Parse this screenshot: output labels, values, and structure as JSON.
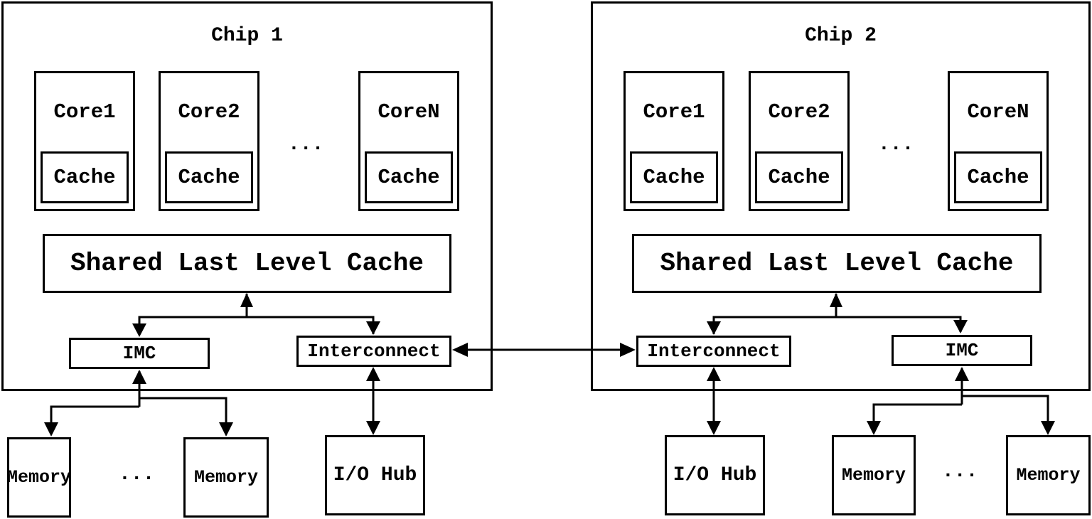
{
  "chips": [
    {
      "title": "Chip 1",
      "cores": [
        {
          "label": "Core1",
          "cache": "Cache"
        },
        {
          "label": "Core2",
          "cache": "Cache"
        },
        {
          "label": "CoreN",
          "cache": "Cache"
        }
      ],
      "ellipsis": "...",
      "llc": "Shared Last Level Cache",
      "imc": "IMC",
      "interconnect": "Interconnect",
      "memory": [
        "Memory",
        "Memory"
      ],
      "memory_ellipsis": "...",
      "io_hub": "I/O Hub"
    },
    {
      "title": "Chip 2",
      "cores": [
        {
          "label": "Core1",
          "cache": "Cache"
        },
        {
          "label": "Core2",
          "cache": "Cache"
        },
        {
          "label": "CoreN",
          "cache": "Cache"
        }
      ],
      "ellipsis": "...",
      "llc": "Shared Last Level Cache",
      "imc": "IMC",
      "interconnect": "Interconnect",
      "memory": [
        "Memory",
        "Memory"
      ],
      "memory_ellipsis": "...",
      "io_hub": "I/O Hub"
    }
  ]
}
